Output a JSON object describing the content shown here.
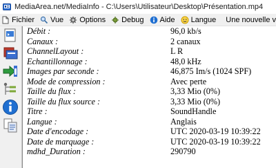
{
  "window": {
    "title": "MediaArea.net/MediaInfo - C:\\Users\\Utilisateur\\Desktop\\Présentation.mp4"
  },
  "menu": {
    "items": [
      {
        "label": "Fichier",
        "icon": "file-icon"
      },
      {
        "label": "Vue",
        "icon": "view-icon"
      },
      {
        "label": "Options",
        "icon": "options-icon"
      },
      {
        "label": "Debug",
        "icon": "debug-icon"
      },
      {
        "label": "Aide",
        "icon": "help-icon"
      },
      {
        "label": "Langue",
        "icon": "language-icon"
      }
    ],
    "update_notice": "Une nouvelle version est disponible"
  },
  "sidebar": {
    "buttons": [
      "open-file-icon",
      "open-folder-icon",
      "export-icon",
      "tree-view-icon",
      "info-icon",
      "copy-icon"
    ]
  },
  "info": {
    "rows": [
      {
        "key": "Débit :",
        "value": "96,0 kb/s"
      },
      {
        "key": "Canaux :",
        "value": "2 canaux"
      },
      {
        "key": "ChannelLayout :",
        "value": "L R"
      },
      {
        "key": "Echantillonnage :",
        "value": "48,0 kHz"
      },
      {
        "key": "Images par seconde :",
        "value": "46,875 Im/s (1024 SPF)"
      },
      {
        "key": "Mode de compression :",
        "value": "Avec perte"
      },
      {
        "key": "Taille du flux :",
        "value": "3,33 Mio (0%)"
      },
      {
        "key": "Taille du flux source :",
        "value": "3,33 Mio (0%)"
      },
      {
        "key": "Titre :",
        "value": "SoundHandle"
      },
      {
        "key": "Langue :",
        "value": "Anglais"
      },
      {
        "key": "Date d'encodage :",
        "value": "UTC 2020-03-19 10:39:22"
      },
      {
        "key": "Date de marquage :",
        "value": "UTC 2020-03-19 10:39:22"
      },
      {
        "key": "mdhd_Duration :",
        "value": "290790"
      }
    ]
  }
}
